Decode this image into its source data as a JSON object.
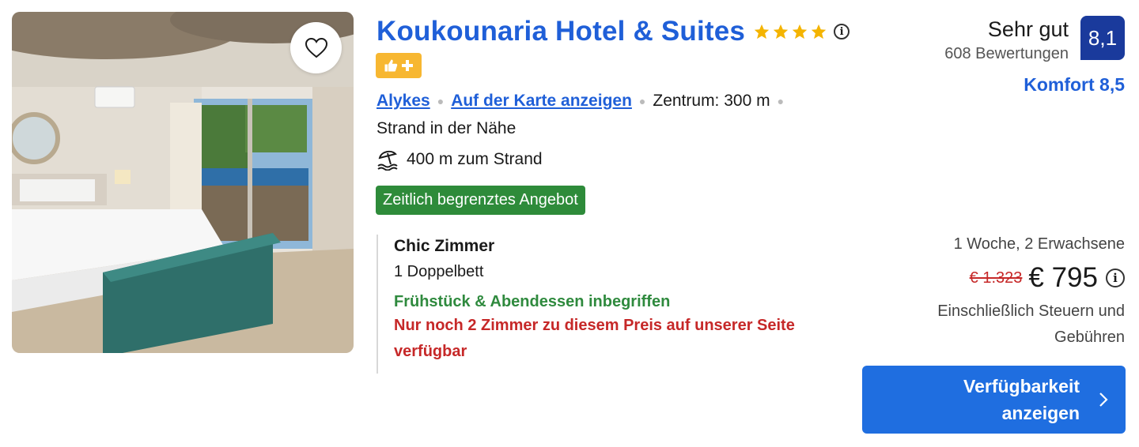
{
  "hotel": {
    "name": "Koukounaria Hotel & Suites",
    "star_count": 4,
    "info_icon": "i"
  },
  "icons": {
    "favorite": "heart-icon",
    "promo": [
      "thumbs-up-icon",
      "plus-icon"
    ],
    "beach": "beach-umbrella-icon",
    "cta": "chevron-right-icon"
  },
  "location": {
    "area": "Alykes",
    "map_link": "Auf der Karte anzeigen",
    "center_distance": "Zentrum: 300 m",
    "beach_nearby": "Strand in der Nähe",
    "beach_distance": "400 m zum Strand"
  },
  "deal_badge": "Zeitlich begrenztes Angebot",
  "room": {
    "name": "Chic Zimmer",
    "bed": "1 Doppelbett",
    "meals": "Frühstück & Abendessen inbegriffen",
    "scarcity": "Nur noch 2 Zimmer zu diesem Preis auf unserer Seite verfügbar"
  },
  "rating": {
    "label": "Sehr gut",
    "reviews": "608 Bewertungen",
    "score": "8,1",
    "comfort": "Komfort 8,5"
  },
  "pricing": {
    "stay": "1 Woche, 2 Erwachsene",
    "old_price": "€ 1.323",
    "price": "€ 795",
    "tax_note": "Einschließlich Steuern und Gebühren"
  },
  "cta_label": "Verfügbarkeit anzeigen",
  "colors": {
    "link_blue": "#1f5fd8",
    "score_navy": "#1a3a9c",
    "deal_green": "#2e8b3a",
    "meal_green": "#2f8a3e",
    "alert_red": "#c62828",
    "star_gold": "#f4b400",
    "promo_yellow": "#f7b731",
    "cta_blue": "#1f6ee0"
  }
}
